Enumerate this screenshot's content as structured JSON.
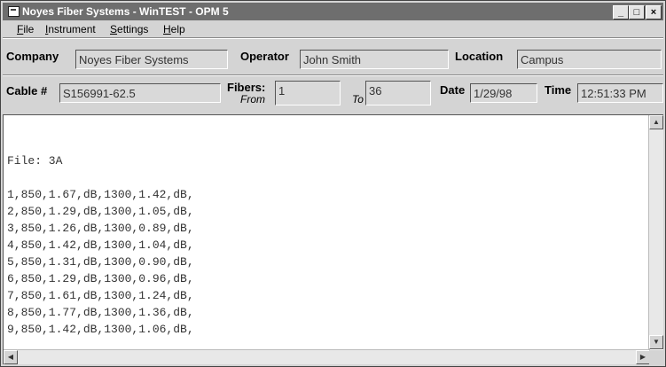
{
  "window": {
    "title": "Noyes Fiber Systems - WinTEST - OPM 5"
  },
  "controls": {
    "minimize": "_",
    "maximize": "□",
    "close": "×"
  },
  "menu": [
    {
      "pre": "",
      "key": "F",
      "post": "ile"
    },
    {
      "pre": "",
      "key": "I",
      "post": "nstrument"
    },
    {
      "pre": "",
      "key": "S",
      "post": "ettings"
    },
    {
      "pre": "",
      "key": "H",
      "post": "elp"
    }
  ],
  "header": {
    "company_label": "Company",
    "company_value": "Noyes Fiber Systems",
    "operator_label": "Operator",
    "operator_value": "John Smith",
    "location_label": "Location",
    "location_value": "Campus",
    "cable_label": "Cable #",
    "cable_value": "S156991-62.5",
    "fibers_label": "Fibers:",
    "from_label": "From",
    "from_value": "1",
    "to_label": "To",
    "to_value": "36",
    "date_label": "Date",
    "date_value": "1/29/98",
    "time_label": "Time",
    "time_value": "12:51:33 PM"
  },
  "report": {
    "file_line": "File: 3A",
    "rows": [
      "1,850,1.67,dB,1300,1.42,dB,",
      "2,850,1.29,dB,1300,1.05,dB,",
      "3,850,1.26,dB,1300,0.89,dB,",
      "4,850,1.42,dB,1300,1.04,dB,",
      "5,850,1.31,dB,1300,0.90,dB,",
      "6,850,1.29,dB,1300,0.96,dB,",
      "7,850,1.61,dB,1300,1.24,dB,",
      "8,850,1.77,dB,1300,1.36,dB,",
      "9,850,1.42,dB,1300,1.06,dB,"
    ]
  }
}
